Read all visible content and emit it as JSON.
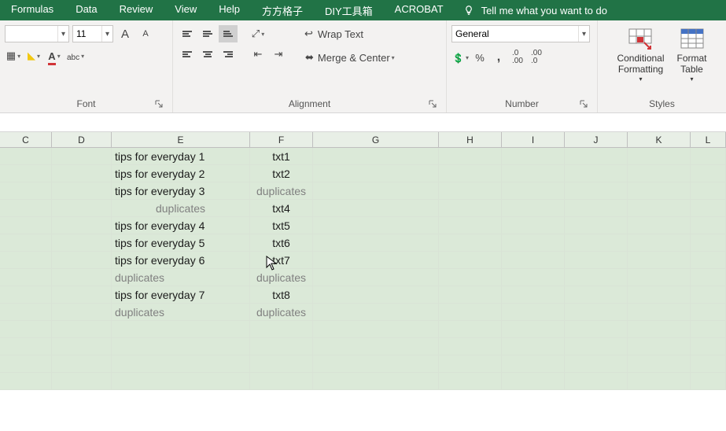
{
  "menubar": {
    "tabs": [
      "Formulas",
      "Data",
      "Review",
      "View",
      "Help",
      "方方格子",
      "DIY工具箱",
      "ACROBAT"
    ],
    "tell_me": "Tell me what you want to do"
  },
  "ribbon": {
    "font": {
      "name": "",
      "size": "11",
      "labels": {
        "grow": "A",
        "shrink": "A"
      },
      "group_label": "Font"
    },
    "alignment": {
      "wrap": "Wrap Text",
      "merge": "Merge & Center",
      "group_label": "Alignment"
    },
    "number": {
      "format": "General",
      "group_label": "Number",
      "inc_dec": {
        "inc": ".0\n.00",
        "dec": ".00\n.0"
      }
    },
    "styles": {
      "conditional": "Conditional\nFormatting",
      "format_table": "Format\nTable",
      "group_label": "Styles"
    }
  },
  "grid": {
    "columns": [
      "C",
      "D",
      "E",
      "F",
      "G",
      "H",
      "I",
      "J",
      "K",
      "L"
    ],
    "rows": [
      {
        "E": "tips for everyday 1",
        "F": "txt1"
      },
      {
        "E": "tips for everyday 2",
        "F": "txt2"
      },
      {
        "E": "tips for everyday 3",
        "F": "duplicates",
        "F_gray": true
      },
      {
        "E": "duplicates",
        "E_gray": true,
        "E_center": true,
        "F": "txt4"
      },
      {
        "E": "tips for everyday 4",
        "F": "txt5"
      },
      {
        "E": "tips for everyday 5",
        "F": "txt6"
      },
      {
        "E": "tips for everyday 6",
        "F": "txt7"
      },
      {
        "E": "duplicates",
        "E_gray": true,
        "F": "duplicates",
        "F_gray": true
      },
      {
        "E": "tips for everyday 7",
        "F": "txt8"
      },
      {
        "E": "duplicates",
        "E_gray": true,
        "F": "duplicates",
        "F_gray": true
      },
      {},
      {},
      {},
      {}
    ]
  }
}
